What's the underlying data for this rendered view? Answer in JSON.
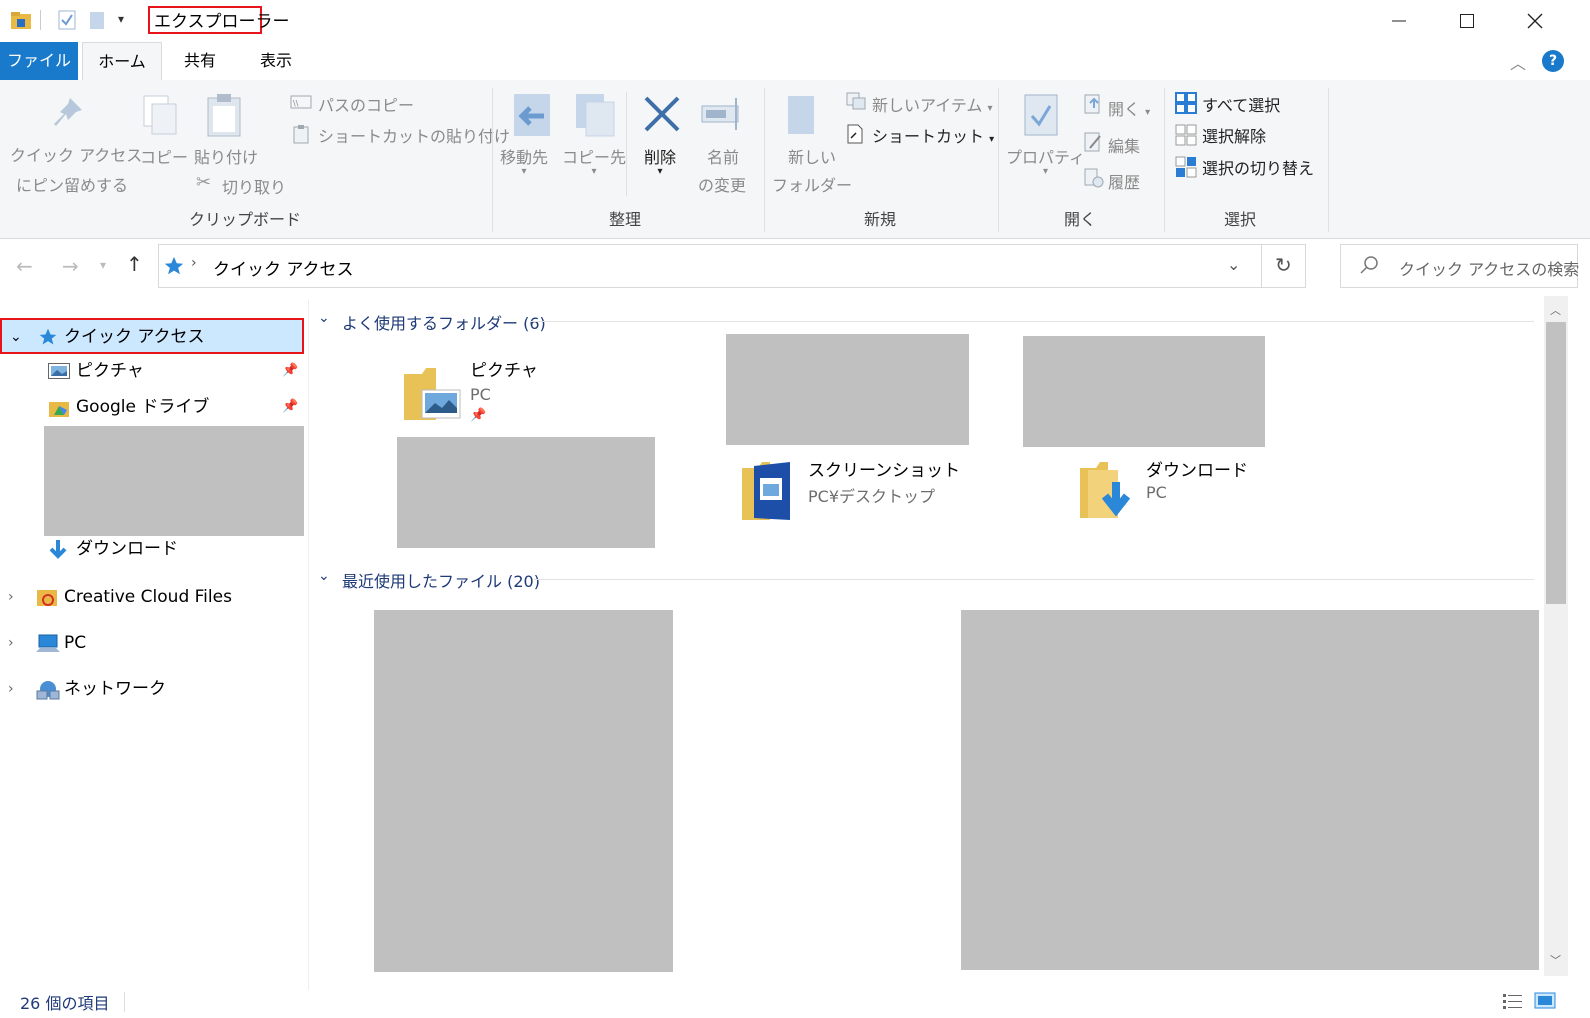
{
  "window": {
    "title": "エクスプローラー"
  },
  "tabs": [
    "ファイル",
    "ホーム",
    "共有",
    "表示"
  ],
  "ribbon": {
    "clipboard": {
      "pin_label_1": "クイック アクセス",
      "pin_label_2": "にピン留めする",
      "copy": "コピー",
      "paste": "貼り付け",
      "copy_path": "パスのコピー",
      "paste_shortcut": "ショートカットの貼り付け",
      "cut": "切り取り",
      "group": "クリップボード"
    },
    "organize": {
      "move_to": "移動先",
      "copy_to": "コピー先",
      "delete": "削除",
      "rename_1": "名前",
      "rename_2": "の変更",
      "group": "整理"
    },
    "new": {
      "new_folder_1": "新しい",
      "new_folder_2": "フォルダー",
      "new_item": "新しいアイテム",
      "shortcut": "ショートカット",
      "group": "新規"
    },
    "open": {
      "properties": "プロパティ",
      "open": "開く",
      "edit": "編集",
      "history": "履歴",
      "group": "開く"
    },
    "select": {
      "select_all": "すべて選択",
      "select_none": "選択解除",
      "invert": "選択の切り替え",
      "group": "選択"
    }
  },
  "address": {
    "path": "クイック アクセス",
    "search_placeholder": "クイック アクセスの検索"
  },
  "nav": {
    "quick_access": "クイック アクセス",
    "pictures": "ピクチャ",
    "google_drive": "Google ドライブ",
    "downloads": "ダウンロード",
    "creative_cloud": "Creative Cloud Files",
    "pc": "PC",
    "network": "ネットワーク"
  },
  "content": {
    "frequent_header": "よく使用するフォルダー (6)",
    "recent_header": "最近使用したファイル (20)",
    "tiles": [
      {
        "name": "ピクチャ",
        "sub": "PC"
      },
      {
        "name": "スクリーンショット",
        "sub": "PC¥デスクトップ"
      },
      {
        "name": "ダウンロード",
        "sub": "PC"
      }
    ]
  },
  "status": {
    "count": "26 個の項目"
  },
  "colors": {
    "accent": "#1979ca",
    "highlight_border": "#e8141c",
    "selection": "#cce8ff",
    "redacted": "#c0c0c0"
  }
}
